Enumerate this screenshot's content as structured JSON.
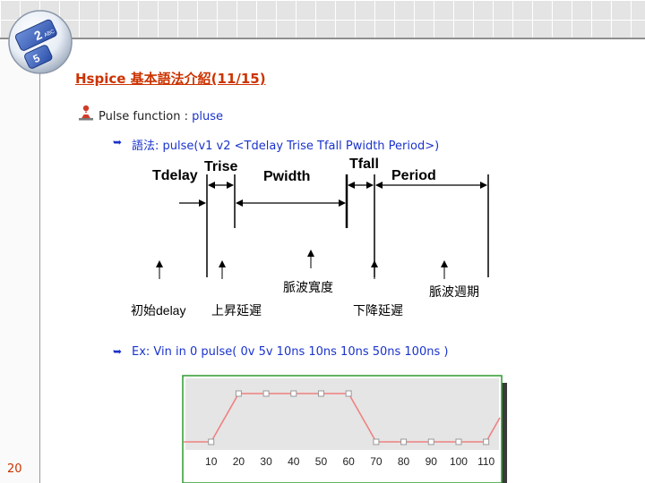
{
  "header": {
    "title": "Hspice 基本語法介紹(11/15)"
  },
  "page_number": "20",
  "logo": {
    "icon": "keypad-logo-icon",
    "key_labels": [
      "2",
      "ABC",
      "5"
    ]
  },
  "bullet_main": {
    "icon": "engineer-figure-icon",
    "label": "Pulse function : ",
    "value": "pluse"
  },
  "bullet_syntax": {
    "icon": "curved-arrow-bullet-icon",
    "glyph": "➥",
    "text": "語法: pulse(v1 v2 <Tdelay Trise Tfall Pwidth Period>)"
  },
  "timing_diagram": {
    "segments": {
      "tdelay": "Tdelay",
      "trise": "Trise",
      "pwidth": "Pwidth",
      "tfall": "Tfall",
      "period": "Period"
    },
    "annotations": {
      "initial_delay": "初始delay",
      "rise_delay": "上昇延遲",
      "pulse_width": "脈波寬度",
      "fall_delay": "下降延遲",
      "pulse_period": "脈波週期"
    }
  },
  "bullet_example": {
    "icon": "curved-arrow-bullet-icon",
    "glyph": "➥",
    "text": "Ex: Vin in 0 pulse( 0v 5v 10ns 10ns 10ns 50ns 100ns )"
  },
  "chart_data": {
    "type": "line",
    "title": "",
    "xlabel": "",
    "ylabel": "",
    "x_ticks": [
      10,
      20,
      30,
      40,
      50,
      60,
      70,
      80,
      90,
      100,
      110
    ],
    "xlim": [
      0,
      115
    ],
    "ylim": [
      0,
      5
    ],
    "grid": false,
    "series": [
      {
        "x": [
          0,
          10,
          20,
          30,
          40,
          50,
          60,
          70,
          80,
          90,
          100,
          110,
          115
        ],
        "y": [
          0,
          0,
          5,
          5,
          5,
          5,
          5,
          0,
          0,
          0,
          0,
          0,
          2.5
        ]
      }
    ],
    "colors": {
      "line": "#f08080",
      "marker_edge": "#999999",
      "plot_bg": "#e5e5e5",
      "frame": "#2e9b2e"
    }
  }
}
